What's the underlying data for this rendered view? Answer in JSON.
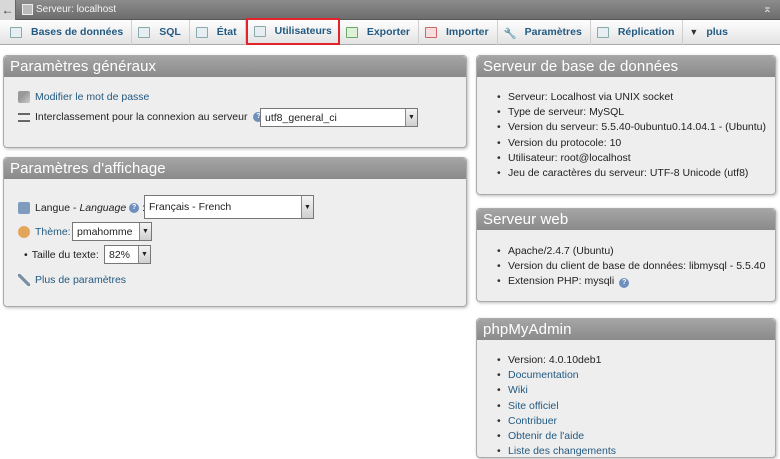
{
  "serverbar": {
    "title": "Serveur: localhost"
  },
  "tabs": [
    {
      "label": "Bases de données"
    },
    {
      "label": "SQL"
    },
    {
      "label": "État"
    },
    {
      "label": "Utilisateurs"
    },
    {
      "label": "Exporter"
    },
    {
      "label": "Importer"
    },
    {
      "label": "Paramètres"
    },
    {
      "label": "Réplication"
    },
    {
      "label": "plus"
    }
  ],
  "general": {
    "title": "Paramètres généraux",
    "change_password": "Modifier le mot de passe",
    "collation_label": "Interclassement pour la connexion au serveur",
    "collation_value": "utf8_general_ci"
  },
  "display": {
    "title": "Paramètres d'affichage",
    "language_label": "Langue - ",
    "language_label_italic": "Language",
    "language_value": "Français - French",
    "theme_label": "Thème:",
    "theme_value": "pmahomme",
    "fontsize_label": "Taille du texte:",
    "fontsize_value": "82%",
    "more_settings": "Plus de paramètres"
  },
  "db_server": {
    "title": "Serveur de base de données",
    "items": [
      "Serveur: Localhost via UNIX socket",
      "Type de serveur: MySQL",
      "Version du serveur: 5.5.40-0ubuntu0.14.04.1 - (Ubuntu)",
      "Version du protocole: 10",
      "Utilisateur: root@localhost",
      "Jeu de caractères du serveur: UTF-8 Unicode (utf8)"
    ]
  },
  "web_server": {
    "title": "Serveur web",
    "items": [
      "Apache/2.4.7 (Ubuntu)",
      "Version du client de base de données: libmysql - 5.5.40",
      "Extension PHP: mysqli"
    ]
  },
  "pma": {
    "title": "phpMyAdmin",
    "version": "Version: 4.0.10deb1",
    "links": [
      "Documentation",
      "Wiki",
      "Site officiel",
      "Contribuer",
      "Obtenir de l'aide",
      "Liste des changements"
    ]
  },
  "colors": {
    "link": "#235a81",
    "active_tab_border": "#e3232c",
    "panel_header": "#999999"
  }
}
